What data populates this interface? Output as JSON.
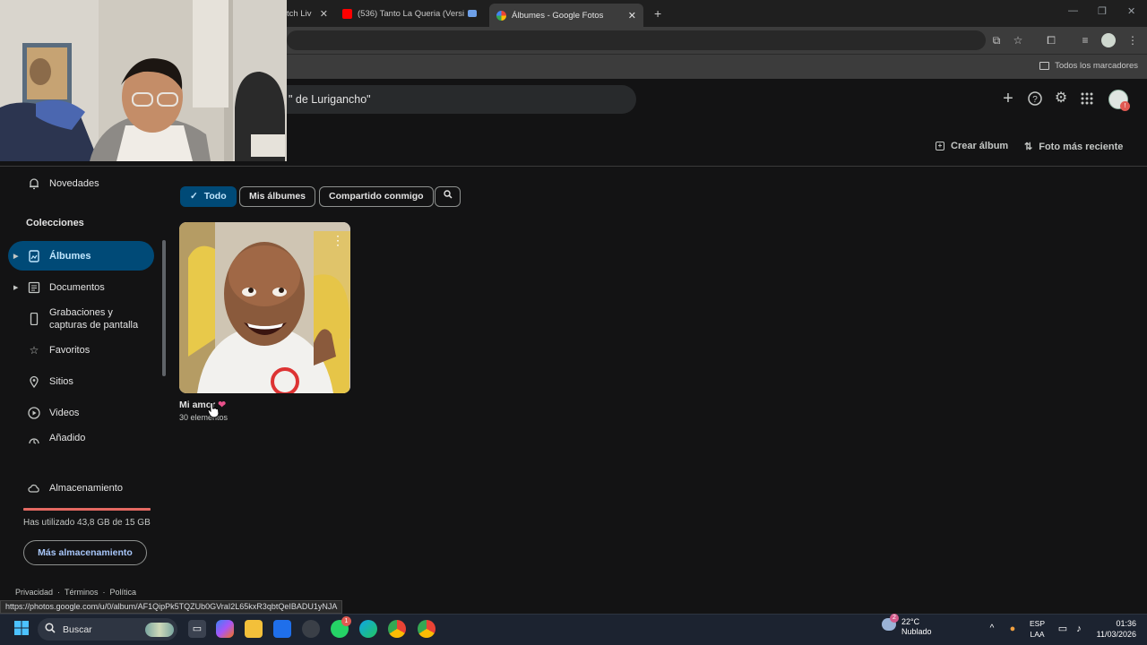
{
  "browser": {
    "tabs": [
      {
        "label": "tch Liv",
        "close": "✕"
      },
      {
        "label": "(536) Tanto La Queria (Versi",
        "close": "✕"
      },
      {
        "label": "Álbumes - Google Fotos",
        "close": "✕"
      }
    ],
    "new_tab": "+",
    "bookmarks_all": "Todos los marcadores",
    "status_url": "https://photos.google.com/u/0/album/AF1QipPk5TQZUb0GVraI2L65kxR3qbtQeIBADU1yNJA"
  },
  "header": {
    "search_text": "\" de Lurigancho\"",
    "avatar_badge": "!"
  },
  "subbar": {
    "create_album": "Crear álbum",
    "recent_photo": "Foto más reciente"
  },
  "sidebar": {
    "novedades": "Novedades",
    "collections_title": "Colecciones",
    "items": [
      {
        "label": "Álbumes"
      },
      {
        "label": "Documentos"
      },
      {
        "label": "Grabaciones y capturas de pantalla"
      },
      {
        "label": "Favoritos"
      },
      {
        "label": "Sitios"
      },
      {
        "label": "Videos"
      },
      {
        "label": "Añadido"
      }
    ],
    "storage_label": "Almacenamiento",
    "storage_used_text": "Has utilizado 43,8 GB de 15 GB",
    "storage_fraction": 1.0,
    "more_storage": "Más almacenamiento",
    "footer": [
      "Privacidad",
      "·",
      "Términos",
      "·",
      "Política"
    ]
  },
  "filters": {
    "chips": [
      "Todo",
      "Mis álbumes",
      "Compartido conmigo"
    ],
    "active_check": "✓"
  },
  "album": {
    "title": "Mi amor",
    "heart": "❤",
    "count": "30 elementos"
  },
  "taskbar": {
    "search": "Buscar",
    "weather_temp": "22°C",
    "weather_desc": "Nublado",
    "weather_badge": "2",
    "lang_1": "ESP",
    "lang_2": "LAA",
    "time": "01:36",
    "date": "11/03/2026",
    "whatsapp_badge": "1"
  },
  "colors": {
    "accent": "#004a77",
    "accent_text": "#c2e7ff",
    "storage_warn": "#e46962"
  }
}
